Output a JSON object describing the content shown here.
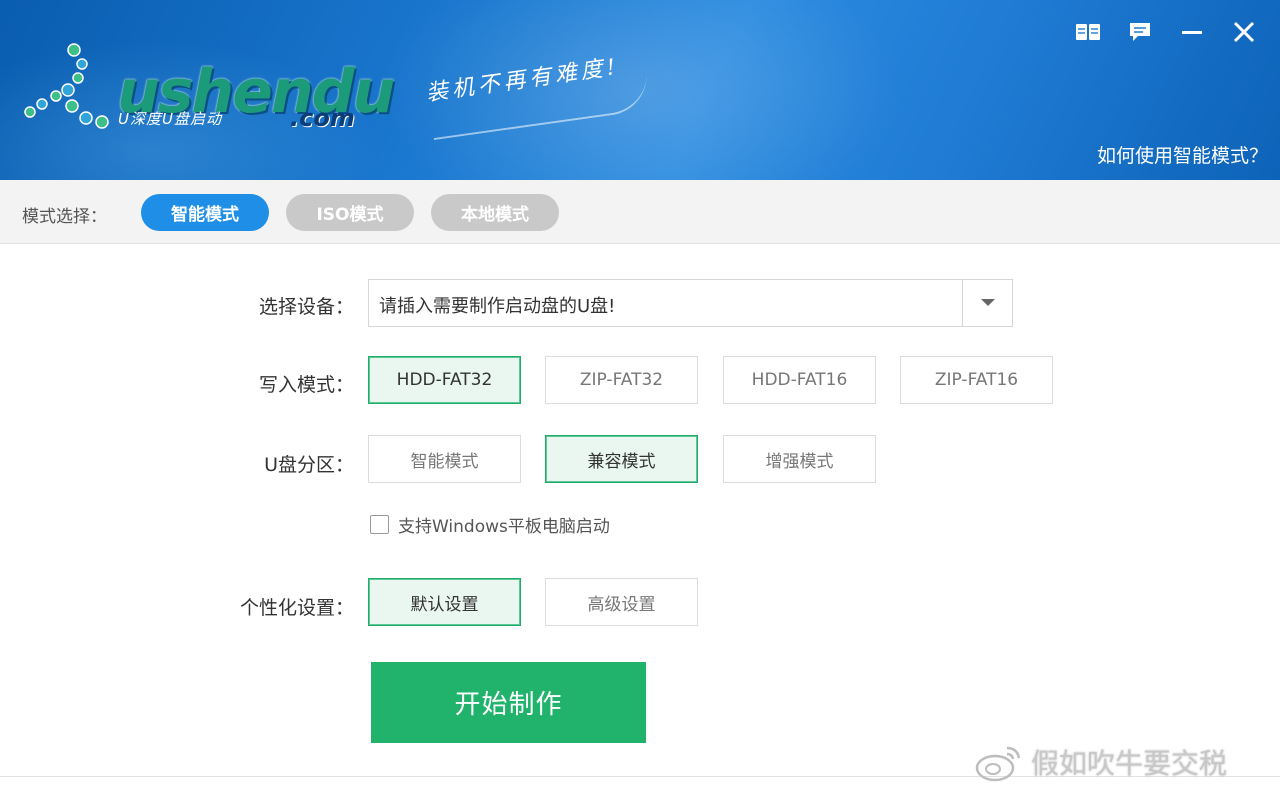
{
  "header": {
    "logo_word": "ushendu",
    "logo_subtitle": "U深度U盘启动",
    "logo_domain": ".com",
    "slogan": "装机不再有难度!",
    "help_link": "如何使用智能模式？"
  },
  "window_controls": [
    "book-icon",
    "message-icon",
    "minimize-icon",
    "close-icon"
  ],
  "mode_bar": {
    "label": "模式选择：",
    "modes": [
      {
        "label": "智能模式",
        "active": true
      },
      {
        "label": "ISO模式",
        "active": false
      },
      {
        "label": "本地模式",
        "active": false
      }
    ]
  },
  "device": {
    "label": "选择设备：",
    "value": "请插入需要制作启动盘的U盘!"
  },
  "write_mode": {
    "label": "写入模式：",
    "options": [
      "HDD-FAT32",
      "ZIP-FAT32",
      "HDD-FAT16",
      "ZIP-FAT16"
    ],
    "selected": "HDD-FAT32"
  },
  "partition": {
    "label": "U盘分区：",
    "options": [
      "智能模式",
      "兼容模式",
      "增强模式"
    ],
    "selected": "兼容模式"
  },
  "tablet_support": {
    "label": "支持Windows平板电脑启动",
    "checked": false
  },
  "personalization": {
    "label": "个性化设置：",
    "options": [
      "默认设置",
      "高级设置"
    ],
    "selected": "默认设置"
  },
  "start_button": "开始制作",
  "watermark": "假如吹牛要交税",
  "colors": {
    "header_blue": "#1a78cf",
    "active_pill": "#1e8ee6",
    "inactive_pill": "#c9c9c9",
    "selected_border": "#22ac6b",
    "start_green": "#21b36c"
  }
}
